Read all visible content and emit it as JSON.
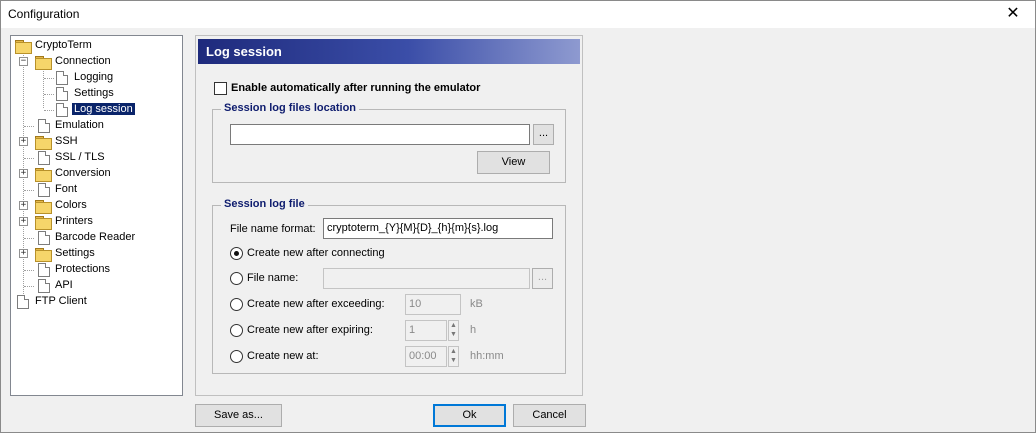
{
  "window": {
    "title": "Configuration",
    "close_glyph": "✕"
  },
  "tree": {
    "items": [
      {
        "label": "CryptoTerm"
      },
      {
        "label": "Connection"
      },
      {
        "label": "Logging"
      },
      {
        "label": "Settings"
      },
      {
        "label": "Log session"
      },
      {
        "label": "Emulation"
      },
      {
        "label": "SSH"
      },
      {
        "label": "SSL / TLS"
      },
      {
        "label": "Conversion"
      },
      {
        "label": "Font"
      },
      {
        "label": "Colors"
      },
      {
        "label": "Printers"
      },
      {
        "label": "Barcode Reader"
      },
      {
        "label": "Settings"
      },
      {
        "label": "Protections"
      },
      {
        "label": "API"
      },
      {
        "label": "FTP Client"
      }
    ],
    "selected": "Log session"
  },
  "panel": {
    "header": "Log session",
    "enable_auto_label": "Enable automatically after running the emulator",
    "location": {
      "legend": "Session log files location",
      "path_value": "",
      "browse_label": "...",
      "view_label": "View"
    },
    "log_file": {
      "legend": "Session log file",
      "format_label": "File name format:",
      "format_value": "cryptoterm_{Y}{M}{D}_{h}{m}{s}.log",
      "options": [
        {
          "label": "Create new after connecting",
          "selected": true
        },
        {
          "label": "File name:",
          "selected": false
        },
        {
          "label": "Create new after exceeding:",
          "selected": false
        },
        {
          "label": "Create new after expiring:",
          "selected": false
        },
        {
          "label": "Create new at:",
          "selected": false
        }
      ],
      "file_name_value": "",
      "file_browse_label": "...",
      "exceeding_value": "10",
      "exceeding_unit": "kB",
      "expiring_value": "1",
      "expiring_unit": "h",
      "at_value": "00:00",
      "at_unit": "hh:mm"
    }
  },
  "footer": {
    "save_as_label": "Save as...",
    "ok_label": "Ok",
    "cancel_label": "Cancel"
  }
}
